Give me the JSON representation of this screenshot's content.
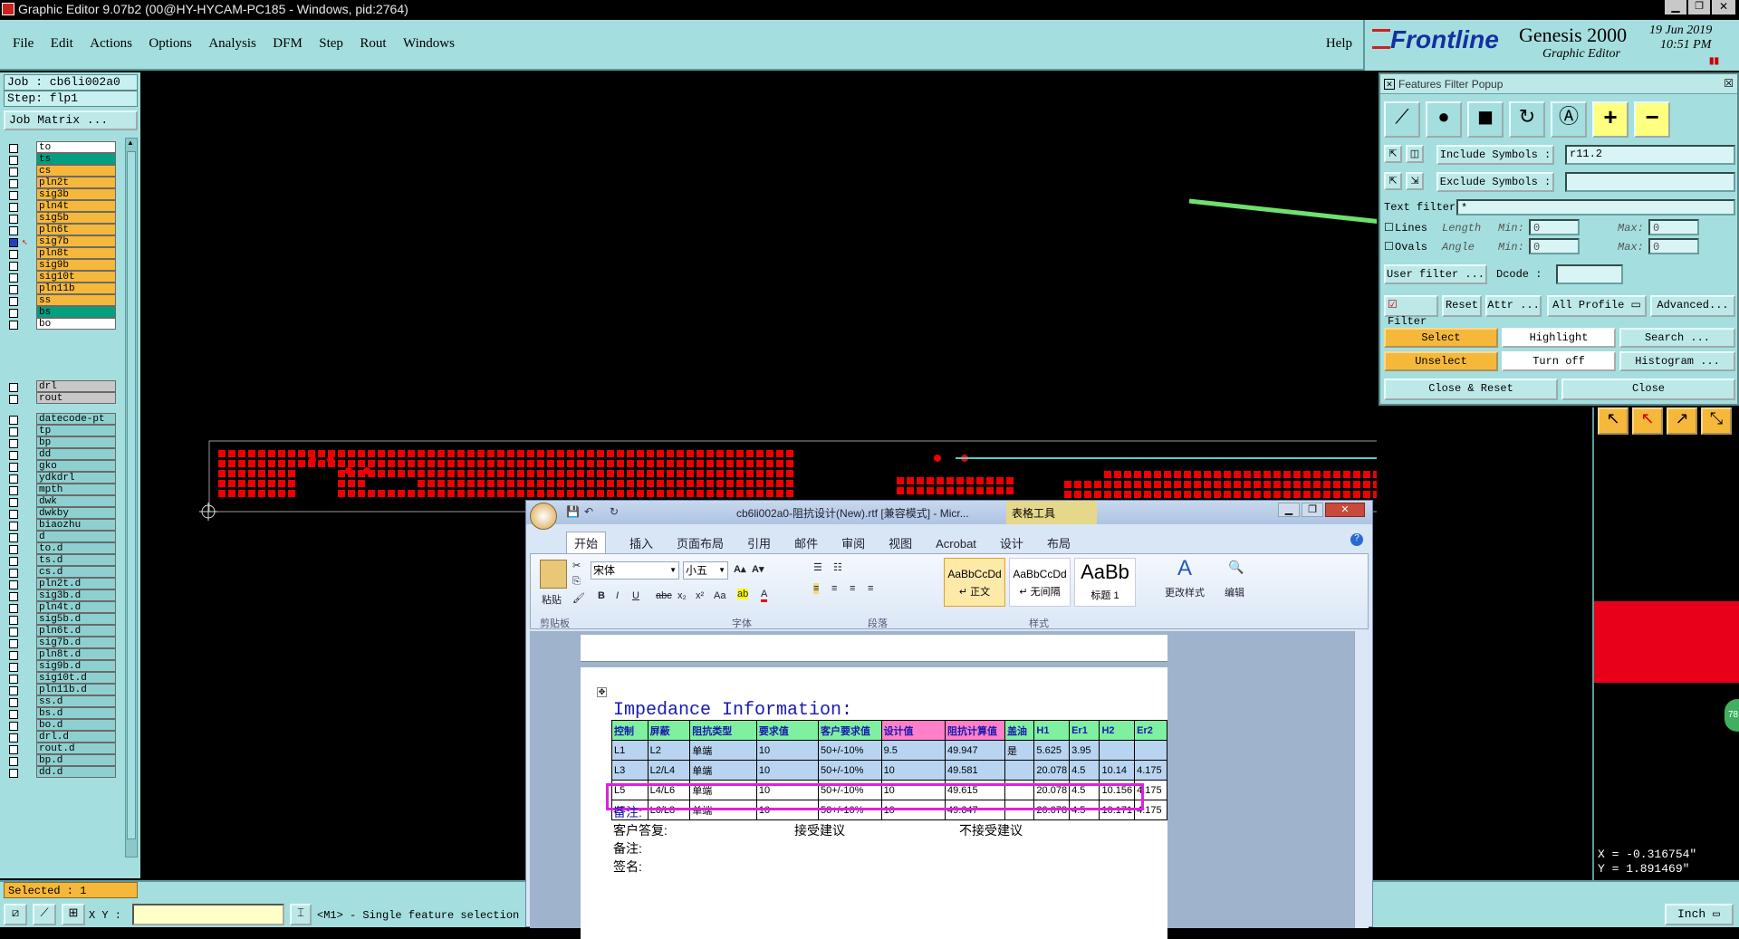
{
  "window": {
    "title": "Graphic Editor 9.07b2 (00@HY-HYCAM-PC185 - Windows, pid:2764)"
  },
  "menu": [
    "File",
    "Edit",
    "Actions",
    "Options",
    "Analysis",
    "DFM",
    "Step",
    "Rout",
    "Windows"
  ],
  "help": "Help",
  "brand": {
    "logo": "Frontline",
    "product": "Genesis 2000",
    "subtitle": "Graphic Editor",
    "date": "19 Jun 2019",
    "time": "10:51 PM"
  },
  "job": {
    "job_label": "Job : cb6li002a0",
    "step_label": "Step: flp1",
    "matrix_button": "Job Matrix ..."
  },
  "layers_group1": [
    {
      "name": "to",
      "color": "#ffffff"
    },
    {
      "name": "ts",
      "color": "#00a080"
    },
    {
      "name": "cs",
      "color": "#f5b83a"
    },
    {
      "name": "pln2t",
      "color": "#f5b83a"
    },
    {
      "name": "sig3b",
      "color": "#f5b83a"
    },
    {
      "name": "pln4t",
      "color": "#f5b83a"
    },
    {
      "name": "sig5b",
      "color": "#f5b83a"
    },
    {
      "name": "pln6t",
      "color": "#f5b83a"
    },
    {
      "name": "sig7b",
      "color": "#f5b83a"
    },
    {
      "name": "pln8t",
      "color": "#f5b83a"
    },
    {
      "name": "sig9b",
      "color": "#f5b83a"
    },
    {
      "name": "sig10t",
      "color": "#f5b83a"
    },
    {
      "name": "pln11b",
      "color": "#f5b83a"
    },
    {
      "name": "ss",
      "color": "#f5b83a"
    },
    {
      "name": "bs",
      "color": "#00a080"
    },
    {
      "name": "bo",
      "color": "#ffffff"
    }
  ],
  "layers_group2": [
    {
      "name": "drl",
      "color": "#c8c8c8"
    },
    {
      "name": "rout",
      "color": "#c8c8c8"
    }
  ],
  "layers_group3": [
    "datecode-pt",
    "tp",
    "bp",
    "dd",
    "gko",
    "ydkdrl",
    "mpth",
    "dwk",
    "dwkby",
    "biaozhu",
    "d",
    "to.d",
    "ts.d",
    "cs.d",
    "pln2t.d",
    "sig3b.d",
    "pln4t.d",
    "sig5b.d",
    "pln6t.d",
    "sig7b.d",
    "pln8t.d",
    "sig9b.d",
    "sig10t.d",
    "pln11b.d",
    "ss.d",
    "bs.d",
    "bo.d",
    "drl.d",
    "rout.d",
    "bp.d",
    "dd.d"
  ],
  "selected": "Selected : 1",
  "status": {
    "xy_label": "X Y :",
    "message": "<M1> - Single feature selection",
    "units": "Inch"
  },
  "coords": {
    "x": "X = -0.316754\"",
    "y": "Y = 1.891469\""
  },
  "ffp": {
    "title": "Features Filter Popup",
    "include_label": "Include Symbols :",
    "include_value": "r11.2",
    "exclude_label": "Exclude Symbols :",
    "exclude_value": "",
    "text_filter_label": "Text filter",
    "text_filter_value": "*",
    "lines": "Lines",
    "ovals": "Ovals",
    "length": "Length",
    "angle": "Angle",
    "min": "Min:",
    "max": "Max:",
    "zero": "0",
    "user_filter": "User filter ...",
    "dcode": "Dcode :",
    "filter": "Filter",
    "reset": "Reset",
    "attr": "Attr ...",
    "all_profile": "All Profile",
    "advanced": "Advanced...",
    "select": "Select",
    "highlight": "Highlight",
    "search": "Search ...",
    "unselect": "Unselect",
    "turn_off": "Turn off",
    "histogram": "Histogram ...",
    "close_reset": "Close & Reset",
    "close": "Close"
  },
  "word": {
    "title": "cb6li002a0-阻抗设计(New).rtf [兼容模式] - Micr...",
    "context_tab": "表格工具",
    "tabs": [
      "开始",
      "插入",
      "页面布局",
      "引用",
      "邮件",
      "审阅",
      "视图",
      "Acrobat",
      "设计",
      "布局"
    ],
    "font_name": "宋体",
    "font_size": "小五",
    "paste": "粘贴",
    "clipboard": "剪贴板",
    "font_group": "字体",
    "paragraph_group": "段落",
    "styles_group": "样式",
    "styles": [
      {
        "preview": "AaBbCcDd",
        "name": "↵ 正文"
      },
      {
        "preview": "AaBbCcDd",
        "name": "↵ 无间隔"
      },
      {
        "preview": "AaBb",
        "name": "标题 1"
      }
    ],
    "change_styles": "更改样式",
    "edit": "编辑",
    "heading": "Impedance Information:",
    "table_header": [
      "控制",
      "屏蔽",
      "阻抗类型",
      "要求值",
      "客户要求值",
      "设计值",
      "阻抗计算值",
      "盖油",
      "H1",
      "Er1",
      "H2",
      "Er2"
    ],
    "table_rows": [
      [
        "L1",
        "L2",
        "单端",
        "10",
        "50+/-10%",
        "9.5",
        "49.947",
        "是",
        "5.625",
        "3.95",
        "",
        ""
      ],
      [
        "L3",
        "L2/L4",
        "单端",
        "10",
        "50+/-10%",
        "10",
        "49.581",
        "",
        "20.078",
        "4.5",
        "10.14",
        "4.175"
      ],
      [
        "L5",
        "L4/L6",
        "单端",
        "10",
        "50+/-10%",
        "10",
        "49.615",
        "",
        "20.078",
        "4.5",
        "10.156",
        "4.175"
      ],
      [
        "L7",
        "L6/L8",
        "单端",
        "10",
        "50+/-10%",
        "10",
        "49.647",
        "",
        "20.078",
        "4.5",
        "10.171",
        "4.175"
      ]
    ],
    "note1": "备注:",
    "reply": "客户答复:",
    "accept": "接受建议",
    "reject": "不接受建议",
    "note2": "备注:",
    "sign": "签名:"
  }
}
